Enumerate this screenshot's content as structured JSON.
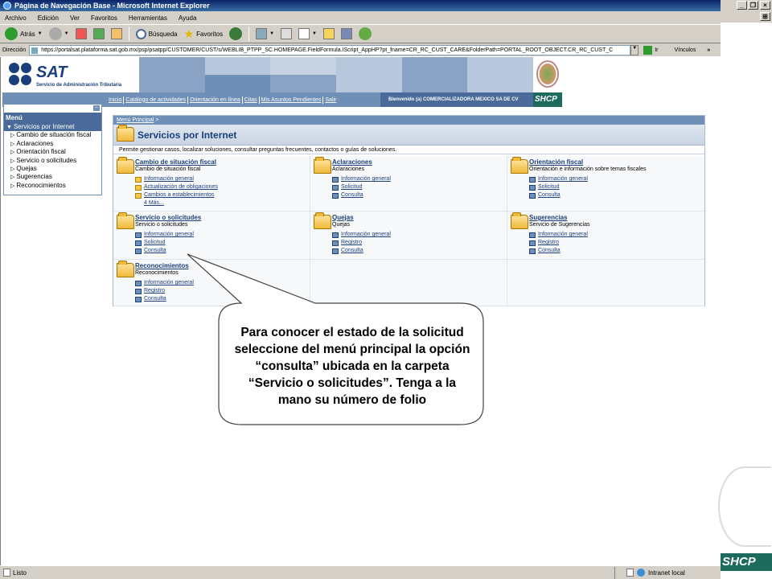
{
  "window": {
    "title": "Página de Navegación Base - Microsoft Internet Explorer",
    "minimize": "_",
    "restore": "❐",
    "close": "×"
  },
  "menubar": [
    "Archivo",
    "Edición",
    "Ver",
    "Favoritos",
    "Herramientas",
    "Ayuda"
  ],
  "toolbar": {
    "back_label": "Atrás",
    "search_label": "Búsqueda",
    "favorites_label": "Favoritos"
  },
  "address": {
    "label": "Dirección",
    "url": "https://portalsat.plataforma.sat.gob.mx/psp/psatpp/CUSTOMER/CUST/s/WEBLIB_PTPP_SC.HOMEPAGE.FieldFormula.IScript_AppHP?pt_fname=CR_RC_CUST_CARE&FolderPath=PORTAL_ROOT_OBJECT.CR_RC_CUST_C",
    "go_label": "Ir",
    "links_label": "Vínculos"
  },
  "header": {
    "brand": "SAT",
    "brand_sub": "Servicio de Administración Tributaria",
    "nav_links": [
      "Inicio",
      "Catálogo de actividades",
      "Orientación en línea",
      "Citas",
      "Mis Asuntos Pendientes",
      "Salir"
    ],
    "welcome": "Bienvenido (a) COMERCIALIZADORA MEXICO SA DE CV",
    "shcp": "SHCP"
  },
  "leftmenu": {
    "collapse": "–",
    "title": "Menú",
    "selected": "Servicios por Internet",
    "items": [
      "Cambio de situación fiscal",
      "Aclaraciones",
      "Orientación fiscal",
      "Servicio o solicitudes",
      "Quejas",
      "Sugerencias",
      "Reconocimientos"
    ]
  },
  "content": {
    "breadcrumb": "Menú Principal",
    "breadcrumb_sep": ">",
    "title": "Servicios por Internet",
    "description": "Permite gestionar casos, localizar soluciones, consultar preguntas frecuentes, contactos o guías de soluciones.",
    "cells": [
      {
        "title": "Cambio de situación fiscal",
        "subtitle": "Cambio de situación fiscal",
        "links": [
          {
            "label": "Información general",
            "icon": "folder"
          },
          {
            "label": "Actualización de obligaciones",
            "icon": "folder"
          },
          {
            "label": "Cambios a establecimientos",
            "icon": "folder"
          },
          {
            "label": "4 Más...",
            "icon": "none"
          }
        ]
      },
      {
        "title": "Aclaraciones",
        "subtitle": "Aclaraciones",
        "links": [
          {
            "label": "Información general",
            "icon": "doc"
          },
          {
            "label": "Solicitud",
            "icon": "doc"
          },
          {
            "label": "Consulta",
            "icon": "doc"
          }
        ]
      },
      {
        "title": "Orientación fiscal",
        "subtitle": "Orientación e información sobre temas fiscales",
        "links": [
          {
            "label": "Información general",
            "icon": "doc"
          },
          {
            "label": "Solicitud",
            "icon": "doc"
          },
          {
            "label": "Consulta",
            "icon": "doc"
          }
        ]
      },
      {
        "title": "Servicio o solicitudes",
        "subtitle": "Servicio o solicitudes",
        "links": [
          {
            "label": "Información general",
            "icon": "doc"
          },
          {
            "label": "Solicitud",
            "icon": "doc"
          },
          {
            "label": "Consulta",
            "icon": "doc"
          }
        ]
      },
      {
        "title": "Quejas",
        "subtitle": "Quejas",
        "links": [
          {
            "label": "Información general",
            "icon": "doc"
          },
          {
            "label": "Registro",
            "icon": "doc"
          },
          {
            "label": "Consulta",
            "icon": "doc"
          }
        ]
      },
      {
        "title": "Sugerencias",
        "subtitle": "Servicio de Sugerencias",
        "links": [
          {
            "label": "Información general",
            "icon": "doc"
          },
          {
            "label": "Registro",
            "icon": "doc"
          },
          {
            "label": "Consulta",
            "icon": "doc"
          }
        ]
      },
      {
        "title": "Reconocimientos",
        "subtitle": "Reconocimientos",
        "links": [
          {
            "label": "Información general",
            "icon": "doc"
          },
          {
            "label": "Registro",
            "icon": "doc"
          },
          {
            "label": "Consulta",
            "icon": "doc"
          }
        ]
      }
    ]
  },
  "callout": {
    "text": "Para conocer el estado de la solicitud seleccione del menú principal la opción “consulta” ubicada en la carpeta “Servicio o solicitudes”. Tenga a la mano su número de folio"
  },
  "statusbar": {
    "left": "Listo",
    "zone": "Intranet local"
  },
  "side": {
    "shcp": "SHCP"
  },
  "colors": {
    "brand_blue": "#1b3f7a",
    "nav_blue": "#6f8fb6",
    "shcp_green": "#1d6b5c",
    "chrome_gray": "#d4d0c8"
  }
}
